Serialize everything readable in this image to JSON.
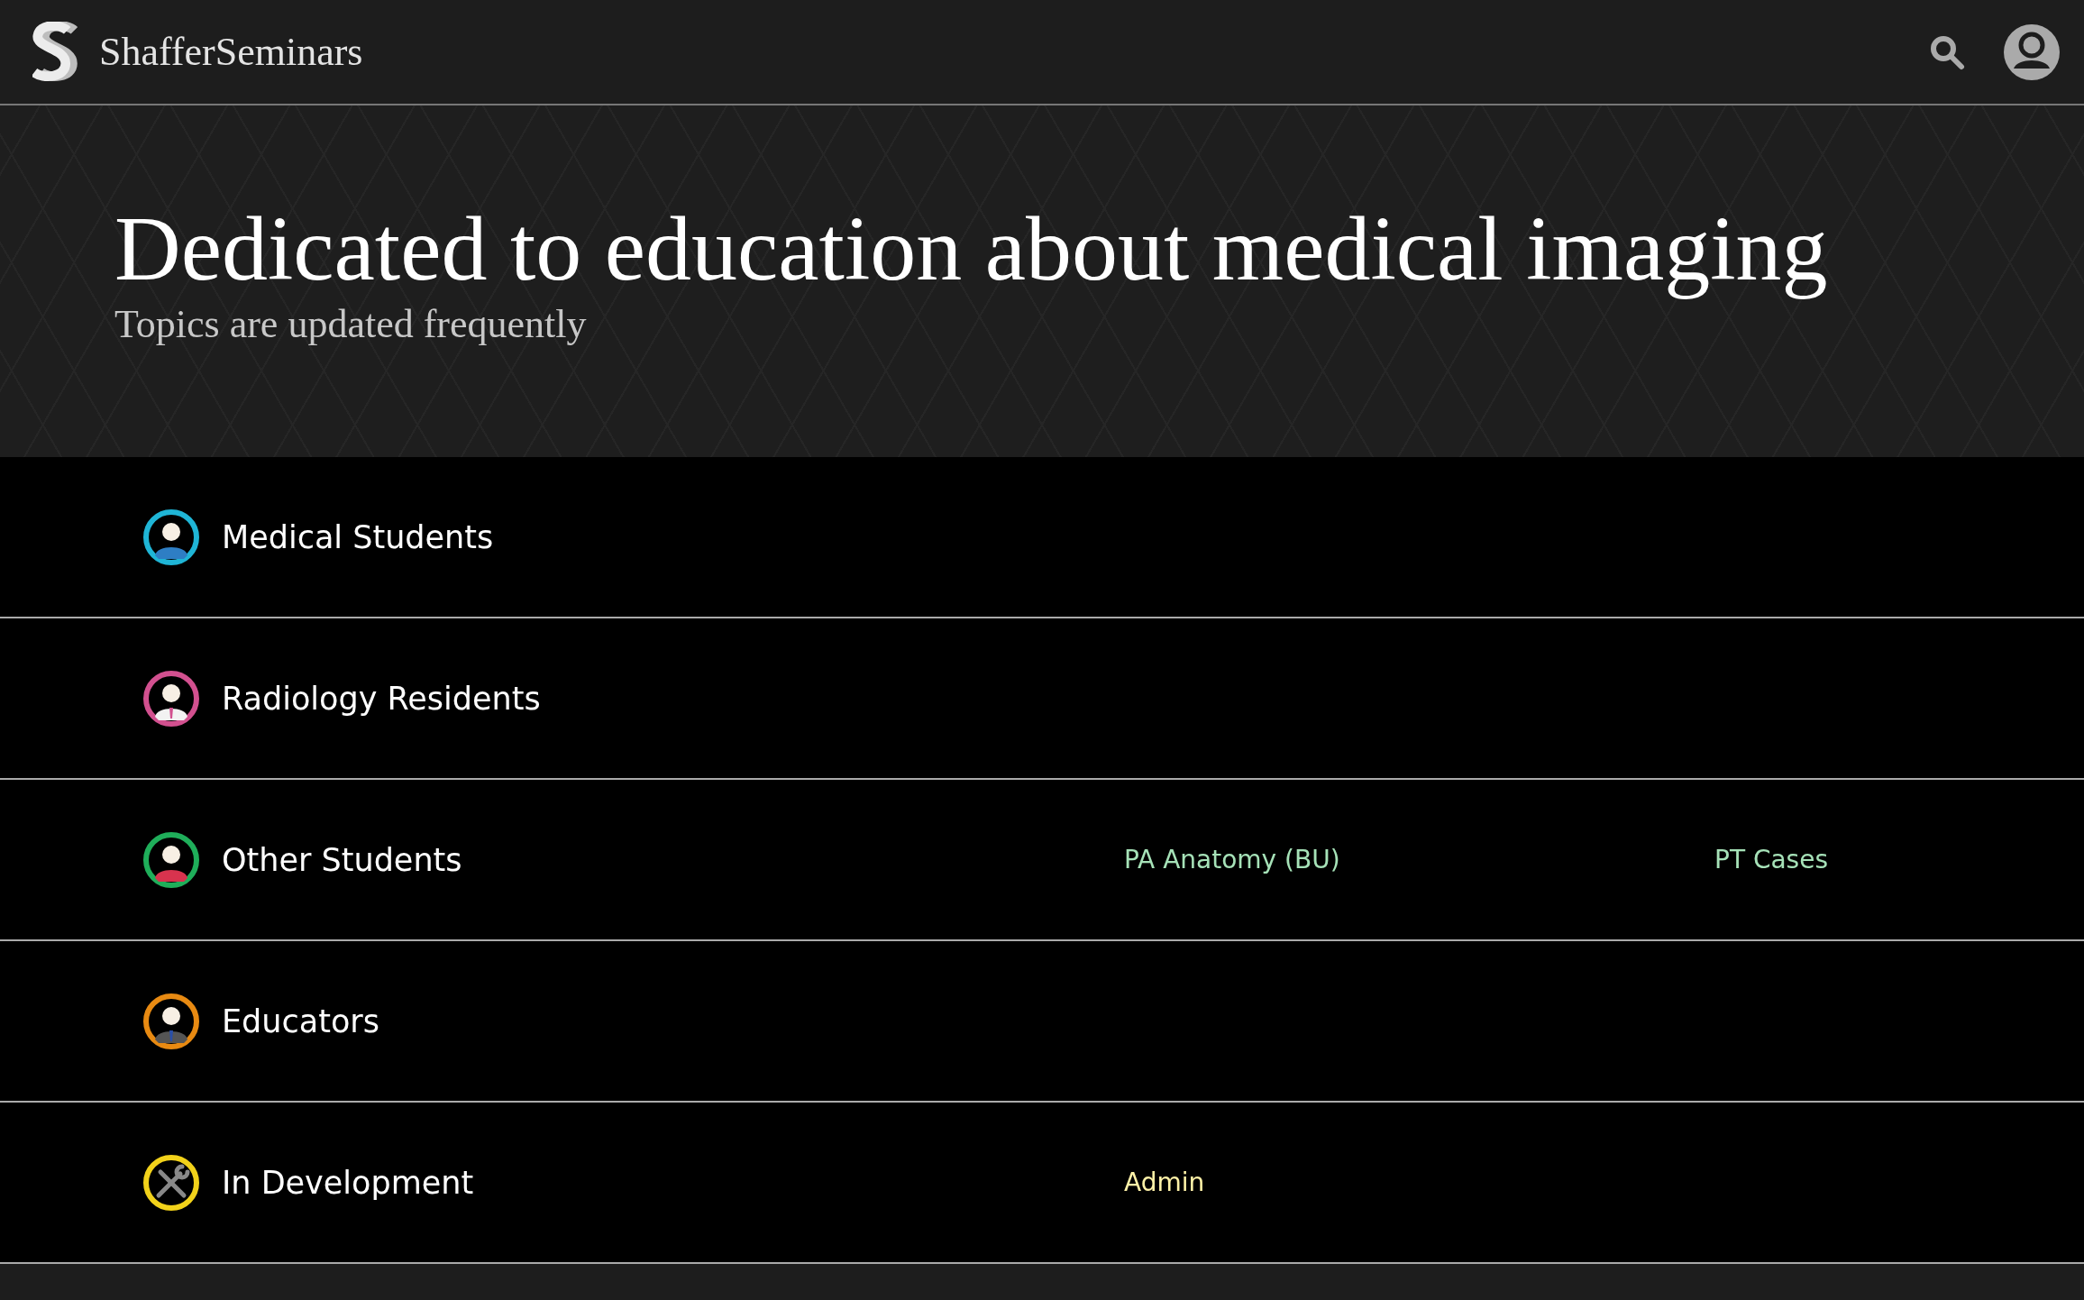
{
  "header": {
    "brand": "ShafferSeminars"
  },
  "hero": {
    "title": "Dedicated to education about medical imaging",
    "subtitle": "Topics are updated frequently"
  },
  "categories": [
    {
      "label": "Medical Students",
      "kind": "doctor",
      "color": "#1fb5d6"
    },
    {
      "label": "Radiology Residents",
      "kind": "resident",
      "color": "#d2508f"
    },
    {
      "label": "Other Students",
      "kind": "student",
      "color": "#1fae5a",
      "links": [
        {
          "label": "PA Anatomy (BU)",
          "color": "#a6e2b8"
        },
        {
          "label": "PT Cases",
          "color": "#a6e2b8"
        }
      ]
    },
    {
      "label": "Educators",
      "kind": "presenter",
      "color": "#e88a12"
    },
    {
      "label": "In Development",
      "kind": "tools",
      "color": "#f2d21a",
      "links": [
        {
          "label": "Admin",
          "color": "#fff2a8"
        }
      ]
    }
  ]
}
